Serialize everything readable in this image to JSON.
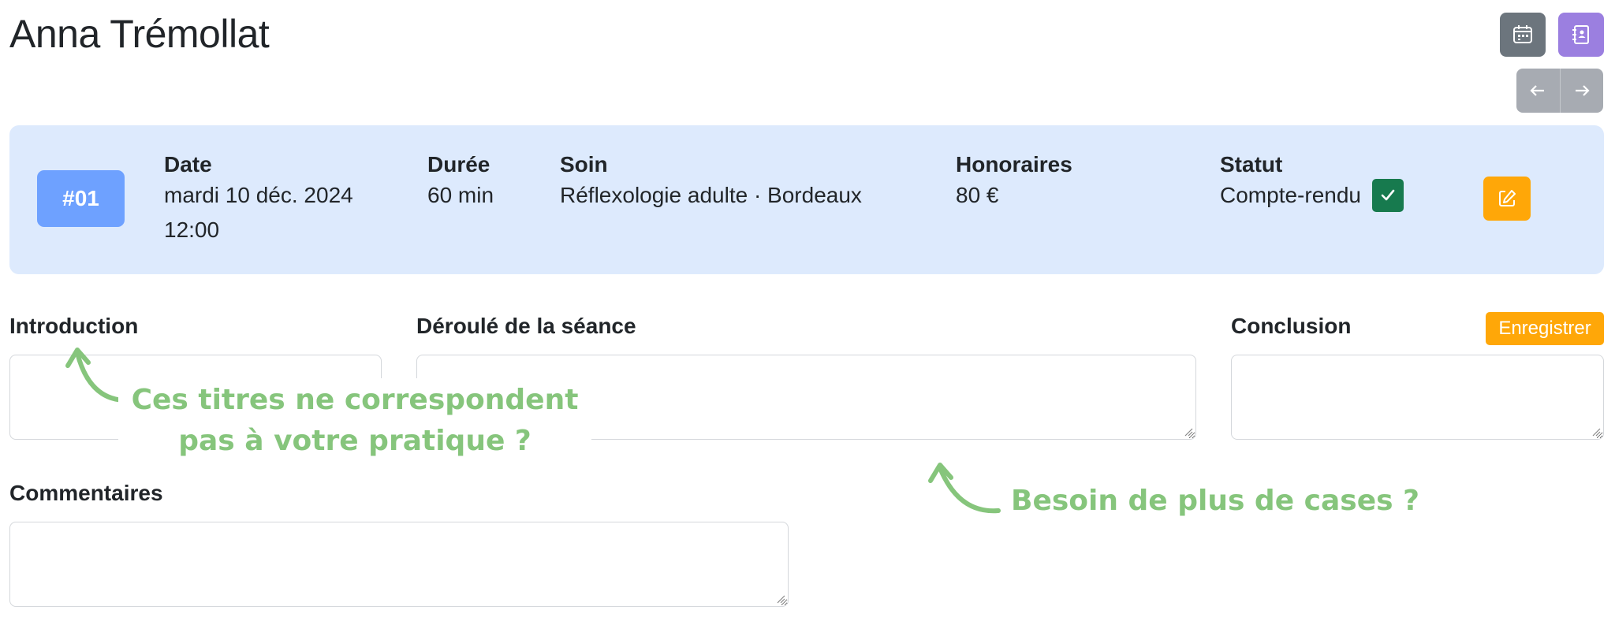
{
  "header": {
    "client_name": "Anna Trémollat",
    "calendar_icon": "calendar-icon",
    "contacts_icon": "address-book-icon",
    "prev_icon": "arrow-left-icon",
    "next_icon": "arrow-right-icon"
  },
  "session": {
    "number": "#01",
    "date_label": "Date",
    "date_value": "mardi 10 déc. 2024",
    "time_value": "12:00",
    "duration_label": "Durée",
    "duration_value": "60 min",
    "soin_label": "Soin",
    "soin_value": "Réflexologie adulte · Bordeaux",
    "fees_label": "Honoraires",
    "fees_value": "80 €",
    "status_label": "Statut",
    "status_value": "Compte-rendu",
    "status_icon": "check-icon",
    "edit_icon": "edit-icon"
  },
  "report": {
    "introduction_label": "Introduction",
    "introduction_value": "",
    "deroule_label": "Déroulé de la séance",
    "deroule_value": "",
    "conclusion_label": "Conclusion",
    "conclusion_value": "",
    "comments_label": "Commentaires",
    "comments_value": "",
    "save_label": "Enregistrer"
  },
  "annotations": {
    "titles_line1": "Ces titres ne correspondent",
    "titles_line2": "pas à votre pratique ?",
    "more_boxes": "Besoin de plus de cases ?"
  },
  "colors": {
    "accent_blue": "#6ea1ff",
    "card_bg": "#ddeafd",
    "warning": "#ffa708",
    "success": "#177a4e",
    "annotation_green": "#86c57c",
    "purple": "#9b7fe0",
    "gray": "#6c757d"
  }
}
